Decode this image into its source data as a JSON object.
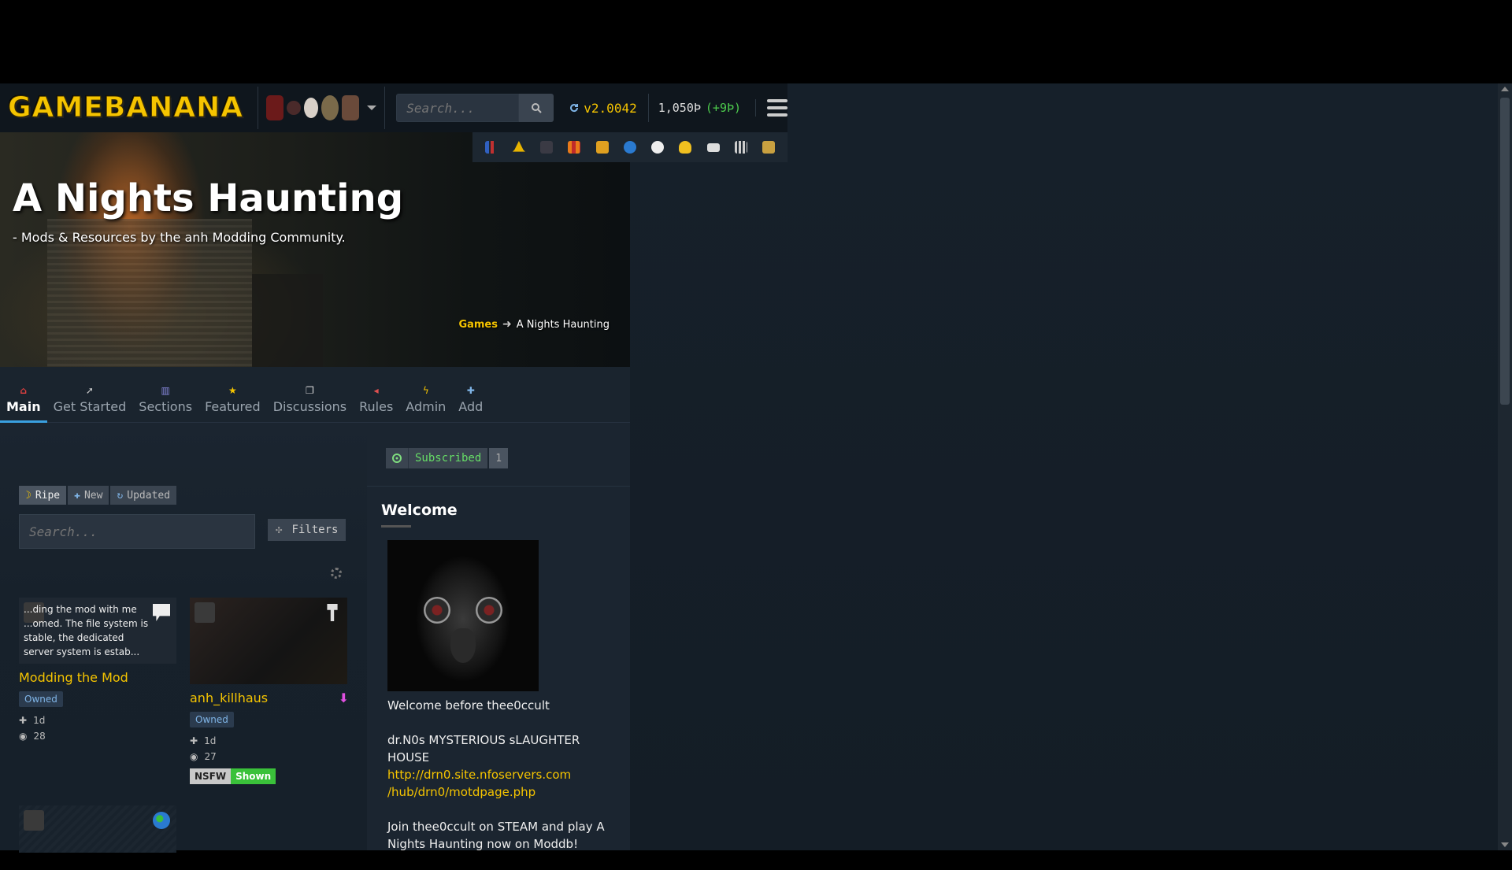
{
  "header": {
    "logo_text": "GAMEBANANA",
    "search_placeholder": "Search...",
    "version": "v2.0042",
    "points": "1,050Þ",
    "points_gain": "(+9Þ)"
  },
  "banner": {
    "title": "A Nights Haunting",
    "subtitle": "- Mods & Resources by the anh Modding Community.",
    "breadcrumb_root": "Games",
    "breadcrumb_current": "A Nights Haunting"
  },
  "nav": {
    "tabs": [
      {
        "label": "Main",
        "icon": "home-icon"
      },
      {
        "label": "Get Started",
        "icon": "rocket-icon"
      },
      {
        "label": "Sections",
        "icon": "sections-icon"
      },
      {
        "label": "Featured",
        "icon": "star-icon"
      },
      {
        "label": "Discussions",
        "icon": "chat-icon"
      },
      {
        "label": "Rules",
        "icon": "megaphone-icon"
      },
      {
        "label": "Admin",
        "icon": "lightning-icon"
      },
      {
        "label": "Add",
        "icon": "plus-icon"
      }
    ]
  },
  "feed": {
    "sort": [
      "Ripe",
      "New",
      "Updated"
    ],
    "search_placeholder": "Search...",
    "filters_label": "Filters",
    "cards": [
      {
        "excerpt": "...ding the mod with me ...omed. The file system is stable, the dedicated server system is estab...",
        "title": "Modding the Mod",
        "badge": "Owned",
        "age": "1d",
        "views": "28"
      },
      {
        "title": "anh_killhaus",
        "badge": "Owned",
        "age": "1d",
        "views": "27",
        "nsfw_label": "NSFW",
        "nsfw_state": "Shown"
      }
    ]
  },
  "sidebar": {
    "subscribed_label": "Subscribed",
    "subscribed_count": "1",
    "welcome_heading": "Welcome",
    "welcome_line1": "Welcome before thee0ccult",
    "welcome_line2": "dr.N0s MYSTERIOUS sLAUGHTER HOUSE",
    "link_part1": "http://drn0.site.nfoservers.com",
    "link_part2": "/hub/drn0/motdpage.php",
    "welcome_line3": "Join thee0ccult on STEAM and play A Nights Haunting now on Moddb!"
  },
  "colors": {
    "accent": "#f5c400",
    "tab_active": "#3aa0e0",
    "shown_green": "#3ac13a"
  }
}
